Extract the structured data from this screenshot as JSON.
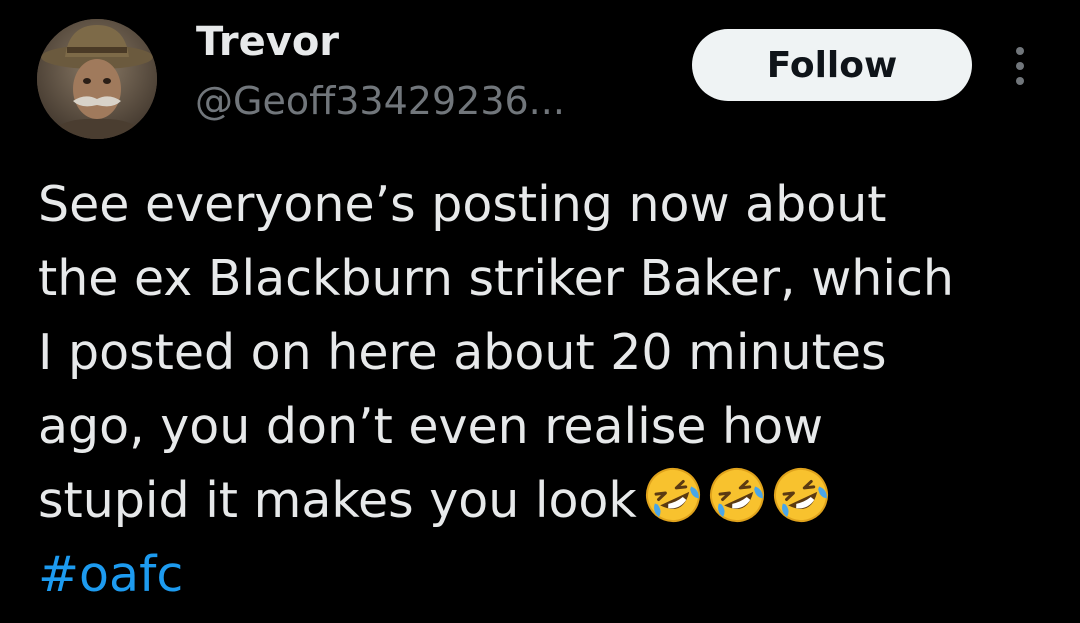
{
  "author": {
    "display_name": "Trevor",
    "handle": "@Geoff33429236..."
  },
  "actions": {
    "follow_label": "Follow",
    "more_icon": "more-vertical-icon"
  },
  "tweet": {
    "lines": [
      "See everyone’s posting now about",
      "the ex Blackburn striker Baker, which",
      "I posted on here about 20 minutes",
      "ago, you don’t even realise how",
      "stupid it makes you look"
    ],
    "emoji": [
      "🤣",
      "🤣",
      "🤣"
    ],
    "emoji_icon": "rolling-on-floor-laughing-emoji",
    "hashtag": "#oafc"
  },
  "colors": {
    "background": "#000000",
    "text": "#e7e9ea",
    "secondary_text": "#71767b",
    "link": "#1d9bf0",
    "follow_button_bg": "#eff3f4"
  }
}
